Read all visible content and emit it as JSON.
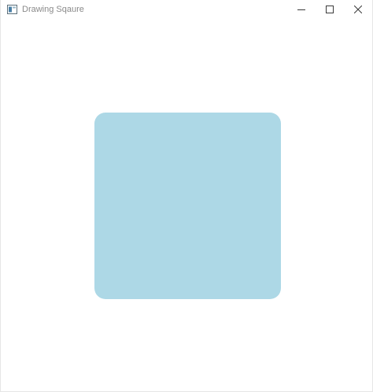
{
  "window": {
    "title": "Drawing Sqaure",
    "icon": "java-app-icon",
    "controls": {
      "minimize_icon": "minimize-icon",
      "maximize_icon": "maximize-icon",
      "close_icon": "close-icon"
    }
  },
  "canvas": {
    "shape": "rounded-square",
    "fill_color": "#add8e6",
    "background_color": "#ffffff"
  }
}
